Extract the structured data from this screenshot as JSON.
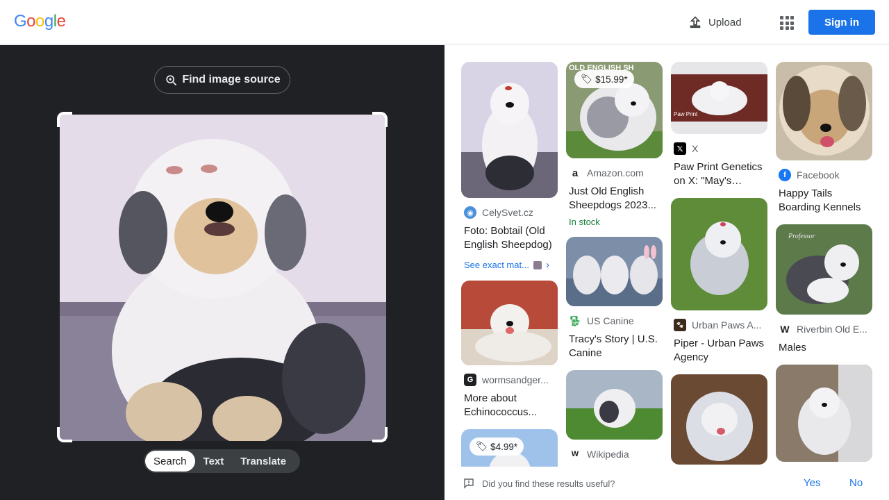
{
  "header": {
    "logo_letters": [
      "G",
      "o",
      "o",
      "g",
      "l",
      "e"
    ],
    "logo_colors": [
      "#4285F4",
      "#EA4335",
      "#FBBC05",
      "#4285F4",
      "#34A853",
      "#EA4335"
    ],
    "upload_label": "Upload",
    "signin_label": "Sign in"
  },
  "lens": {
    "find_source_label": "Find image source",
    "modes": [
      "Search",
      "Text",
      "Translate"
    ],
    "active_mode": "Search"
  },
  "results": {
    "col1": [
      {
        "source": "CelySvet.cz",
        "title": "Foto: Bobtail (Old English Sheepdog)",
        "favicon": "globe-icon",
        "favicon_color": "#4a90d9",
        "see_exact": "See exact mat..."
      },
      {
        "source": "wormsandger...",
        "title": "More about Echinococcus...",
        "favicon": "google-g-icon",
        "favicon_color": "#202124"
      },
      {
        "price": "$4.99*"
      }
    ],
    "col2": [
      {
        "price": "$15.99*",
        "thumb_text": "OLD ENGLISH SH",
        "source": "Amazon.com",
        "title": "Just Old English Sheepdogs 2023...",
        "favicon": "amazon-icon",
        "favicon_color": "#202124",
        "stock": "In stock"
      },
      {
        "source": "US Canine",
        "title": "Tracy's Story | U.S. Canine",
        "favicon": "dog-icon",
        "favicon_color": "#34A853"
      },
      {
        "source": "Wikipedia"
      }
    ],
    "col3": [
      {
        "source": "X",
        "title": "Paw Print Genetics on X: \"May's Bree...",
        "favicon": "x-icon",
        "favicon_color": "#000000",
        "thumb_text": "Paw Print"
      },
      {
        "source": "Urban Paws A...",
        "title": "Piper - Urban Paws Agency",
        "favicon": "paw-icon",
        "favicon_color": "#3c2a1a"
      },
      {}
    ],
    "col4": [
      {
        "source": "Facebook",
        "title": "Happy Tails Boarding Kennels",
        "favicon": "facebook-icon",
        "favicon_color": "#1877F2"
      },
      {
        "source": "Riverbin Old E...",
        "title": "Males",
        "favicon": "w-icon",
        "favicon_color": "#ffffff",
        "thumb_text": "Professor"
      },
      {}
    ]
  },
  "feedback": {
    "question": "Did you find these results useful?",
    "yes": "Yes",
    "no": "No"
  }
}
